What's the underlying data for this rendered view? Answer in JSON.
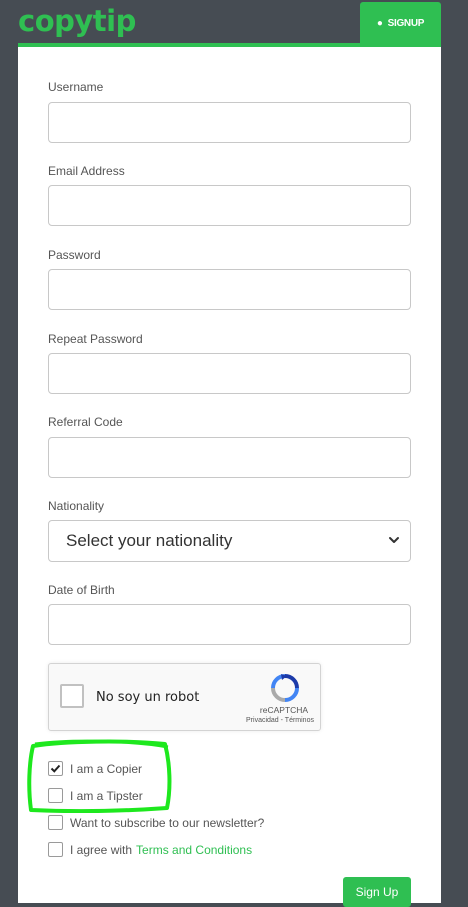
{
  "header": {
    "logo_text": "copytip",
    "signup_tab_label": "SIGNUP",
    "brand_color": "#2fbf52"
  },
  "form": {
    "username_label": "Username",
    "email_label": "Email Address",
    "password_label": "Password",
    "repeat_password_label": "Repeat Password",
    "referral_label": "Referral Code",
    "nationality_label": "Nationality",
    "nationality_selected": "Select your nationality",
    "dob_label": "Date of Birth",
    "recaptcha": {
      "checkbox_text": "No soy un robot",
      "brand": "reCAPTCHA",
      "links": "Privacidad - Términos"
    },
    "checkboxes": [
      {
        "label": "I am a Copier",
        "checked": true
      },
      {
        "label": "I am a Tipster",
        "checked": false
      },
      {
        "label": "Want to subscribe to our newsletter?",
        "checked": false
      },
      {
        "label": "I agree with",
        "link": "Terms and Conditions",
        "checked": false
      }
    ],
    "submit_label": "Sign Up"
  }
}
